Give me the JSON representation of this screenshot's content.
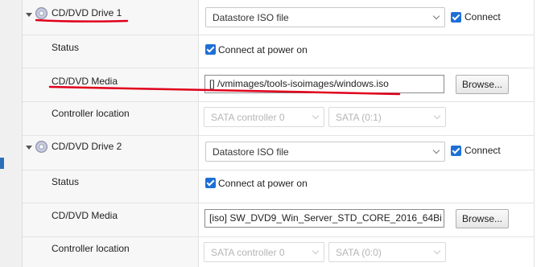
{
  "drives": [
    {
      "title": "CD/DVD Drive 1",
      "media_type": "Datastore ISO file",
      "connect_label": "Connect",
      "status_label": "Status",
      "status_option": "Connect at power on",
      "media_label": "CD/DVD Media",
      "media_path": "[] /vmimages/tools-isoimages/windows.iso",
      "browse_label": "Browse...",
      "controller_label": "Controller location",
      "controller": "SATA controller 0",
      "port": "SATA (0:1)"
    },
    {
      "title": "CD/DVD Drive 2",
      "media_type": "Datastore ISO file",
      "connect_label": "Connect",
      "status_label": "Status",
      "status_option": "Connect at power on",
      "media_label": "CD/DVD Media",
      "media_path": "[iso] SW_DVD9_Win_Server_STD_CORE_2016_64Bi",
      "browse_label": "Browse...",
      "controller_label": "Controller location",
      "controller": "SATA controller 0",
      "port": "SATA (0:0)"
    }
  ],
  "colors": {
    "accent": "#1e6fd6",
    "annotation": "#e0001b"
  },
  "icons": [
    "expand-arrow-icon",
    "cd-dvd-disc-icon",
    "checkbox-checked-icon",
    "chevron-down-icon"
  ]
}
